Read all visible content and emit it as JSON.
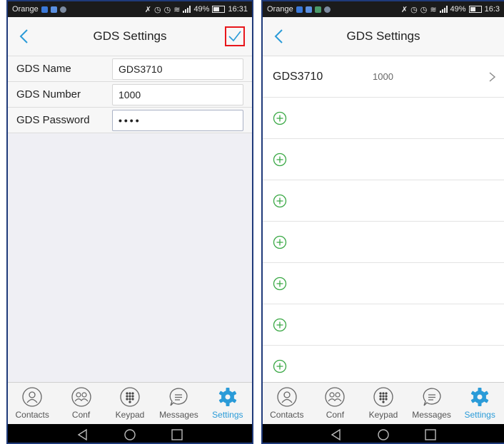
{
  "status": {
    "carrier": "Orange",
    "battery": "49%",
    "time_left": "16:31",
    "time_right": "16:3"
  },
  "left": {
    "title": "GDS Settings",
    "fields": [
      {
        "label": "GDS Name",
        "value": "GDS3710"
      },
      {
        "label": "GDS Number",
        "value": "1000"
      },
      {
        "label": "GDS Password",
        "value": "••••"
      }
    ]
  },
  "right": {
    "title": "GDS Settings",
    "entry": {
      "name": "GDS3710",
      "number": "1000"
    },
    "add_slots": 7
  },
  "tabs": [
    {
      "label": "Contacts",
      "icon": "contacts-icon"
    },
    {
      "label": "Conf",
      "icon": "conference-icon"
    },
    {
      "label": "Keypad",
      "icon": "keypad-icon"
    },
    {
      "label": "Messages",
      "icon": "messages-icon"
    },
    {
      "label": "Settings",
      "icon": "gear-icon",
      "active": true
    }
  ],
  "colors": {
    "accent": "#2a9bd8",
    "highlight": "#e8161b",
    "statusbar": "#1b1b1b",
    "background": "#efeff4"
  }
}
